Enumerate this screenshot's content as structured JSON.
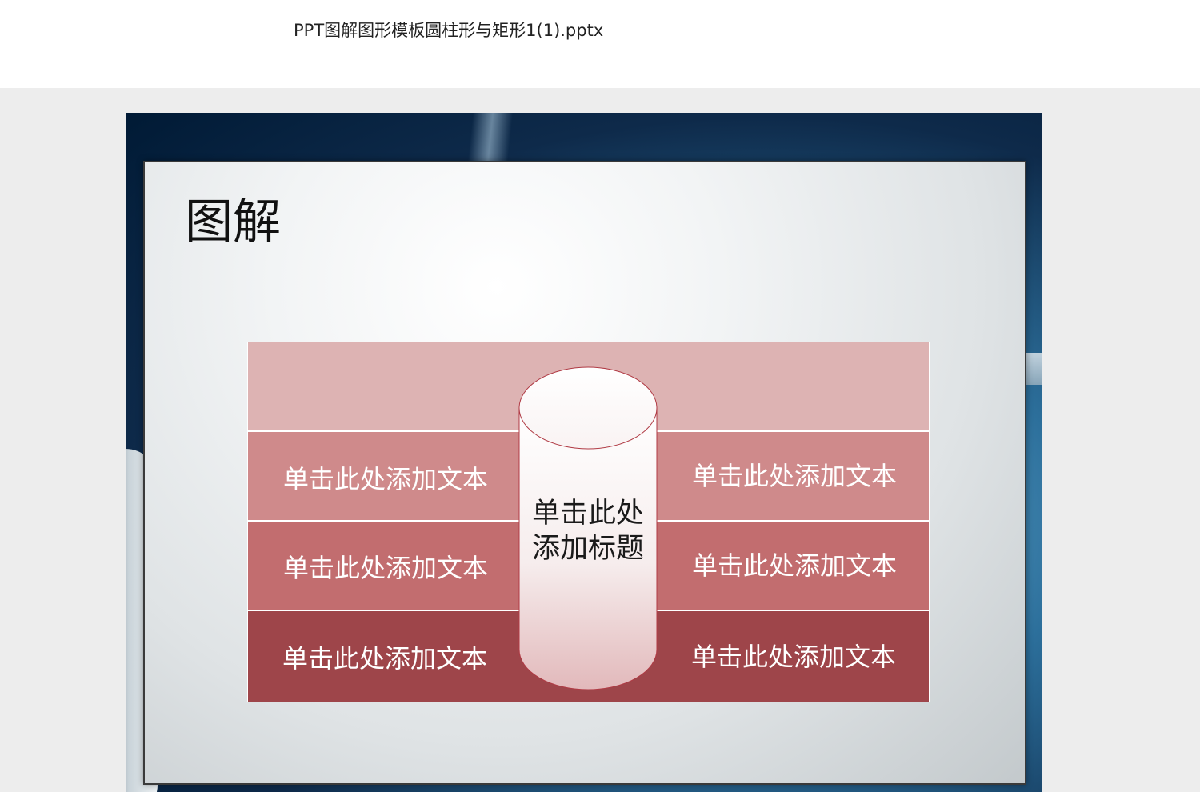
{
  "header": {
    "file_title": "PPT图解图形模板圆柱形与矩形1(1).pptx"
  },
  "slide": {
    "title": "图解",
    "cylinder_title_line1": "单击此处",
    "cylinder_title_line2": "添加标题",
    "rows": [
      {
        "left": "",
        "right": ""
      },
      {
        "left": "单击此处添加文本",
        "right": "单击此处添加文本"
      },
      {
        "left": "单击此处添加文本",
        "right": "单击此处添加文本"
      },
      {
        "left": "单击此处添加文本",
        "right": "单击此处添加文本"
      }
    ]
  },
  "colors": {
    "band_0": "#ddb3b3",
    "band_1": "#cf8a8b",
    "band_2": "#c26d6f",
    "band_3": "#9e454a",
    "cylinder_stroke": "#b03a44"
  }
}
